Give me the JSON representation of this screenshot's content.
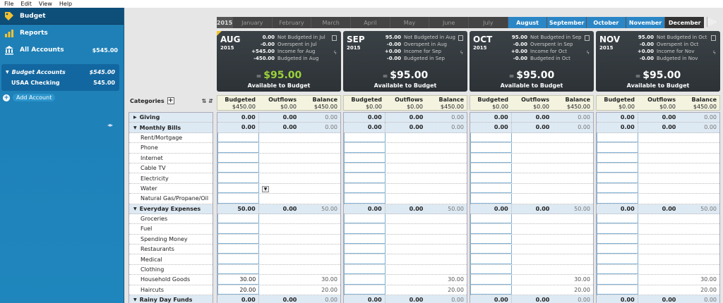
{
  "menu": [
    "File",
    "Edit",
    "View",
    "Help"
  ],
  "sidebar": {
    "nav": [
      {
        "label": "Budget",
        "icon": "tag-icon",
        "amount": ""
      },
      {
        "label": "Reports",
        "icon": "bar-chart-icon",
        "amount": ""
      },
      {
        "label": "All Accounts",
        "icon": "bank-icon",
        "amount": "$545.00"
      }
    ],
    "accounts_title": "Budget Accounts",
    "accounts_total": "$545.00",
    "accounts": [
      {
        "label": "USAA Checking",
        "amount": "545.00"
      }
    ],
    "add_account": "Add Account",
    "collapse_glyph": "◂▸"
  },
  "month_bar": {
    "year": "2015",
    "months": [
      "January",
      "February",
      "March",
      "April",
      "May",
      "June",
      "July",
      "August",
      "September",
      "October",
      "November",
      "December"
    ]
  },
  "categories_label": "Categories",
  "months": [
    {
      "mon": "AUG",
      "year": "2015",
      "vals": [
        "0.00",
        "-0.00",
        "+545.00",
        "-450.00"
      ],
      "labels": [
        "Not Budgeted in Jul",
        "Overspent in Jul",
        "Income for Aug",
        "Budgeted in Aug"
      ],
      "available": "$95.00",
      "available_label": "Available to Budget",
      "budgeted": "$450.00",
      "outflows": "$0.00",
      "balance": "$450.00"
    },
    {
      "mon": "SEP",
      "year": "2015",
      "vals": [
        "95.00",
        "-0.00",
        "+0.00",
        "-0.00"
      ],
      "labels": [
        "Not Budgeted in Aug",
        "Overspent in Aug",
        "Income for Sep",
        "Budgeted in Sep"
      ],
      "available": "$95.00",
      "available_label": "Available to Budget",
      "budgeted": "$0.00",
      "outflows": "$0.00",
      "balance": "$450.00"
    },
    {
      "mon": "OCT",
      "year": "2015",
      "vals": [
        "95.00",
        "-0.00",
        "+0.00",
        "-0.00"
      ],
      "labels": [
        "Not Budgeted in Sep",
        "Overspent in Sep",
        "Income for Oct",
        "Budgeted in Oct"
      ],
      "available": "$95.00",
      "available_label": "Available to Budget",
      "budgeted": "$0.00",
      "outflows": "$0.00",
      "balance": "$450.00"
    },
    {
      "mon": "NOV",
      "year": "2015",
      "vals": [
        "95.00",
        "-0.00",
        "+0.00",
        "-0.00"
      ],
      "labels": [
        "Not Budgeted in Oct",
        "Overspent in Oct",
        "Income for Nov",
        "Budgeted in Nov"
      ],
      "available": "$95.00",
      "available_label": "Available to Budget",
      "budgeted": "$0.00",
      "outflows": "$0.00",
      "balance": "$450.00"
    }
  ],
  "col_headers": [
    "Budgeted",
    "Outflows",
    "Balance"
  ],
  "rows": [
    {
      "name": "Giving",
      "group": true,
      "vals": [
        [
          "0.00",
          "0.00",
          "0.00"
        ],
        [
          "0.00",
          "0.00",
          "0.00"
        ],
        [
          "0.00",
          "0.00",
          "0.00"
        ],
        [
          "0.00",
          "0.00",
          "0.00"
        ]
      ]
    },
    {
      "name": "Monthly Bills",
      "group": true,
      "vals": [
        [
          "0.00",
          "0.00",
          "0.00"
        ],
        [
          "0.00",
          "0.00",
          "0.00"
        ],
        [
          "0.00",
          "0.00",
          "0.00"
        ],
        [
          "0.00",
          "0.00",
          "0.00"
        ]
      ]
    },
    {
      "name": "Rent/Mortgage",
      "group": false,
      "vals": [
        [
          "",
          "",
          ""
        ],
        [
          "",
          "",
          ""
        ],
        [
          "",
          "",
          ""
        ],
        [
          "",
          "",
          ""
        ]
      ]
    },
    {
      "name": "Phone",
      "group": false,
      "vals": [
        [
          "",
          "",
          ""
        ],
        [
          "",
          "",
          ""
        ],
        [
          "",
          "",
          ""
        ],
        [
          "",
          "",
          ""
        ]
      ]
    },
    {
      "name": "Internet",
      "group": false,
      "vals": [
        [
          "",
          "",
          ""
        ],
        [
          "",
          "",
          ""
        ],
        [
          "",
          "",
          ""
        ],
        [
          "",
          "",
          ""
        ]
      ]
    },
    {
      "name": "Cable TV",
      "group": false,
      "vals": [
        [
          "",
          "",
          ""
        ],
        [
          "",
          "",
          ""
        ],
        [
          "",
          "",
          ""
        ],
        [
          "",
          "",
          ""
        ]
      ]
    },
    {
      "name": "Electricity",
      "group": false,
      "vals": [
        [
          "",
          "",
          ""
        ],
        [
          "",
          "",
          ""
        ],
        [
          "",
          "",
          ""
        ],
        [
          "",
          "",
          ""
        ]
      ]
    },
    {
      "name": "Water",
      "group": false,
      "vals": [
        [
          "",
          "",
          ""
        ],
        [
          "",
          "",
          ""
        ],
        [
          "",
          "",
          ""
        ],
        [
          "",
          "",
          ""
        ]
      ]
    },
    {
      "name": "Natural Gas/Propane/Oil",
      "group": false,
      "vals": [
        [
          "",
          "",
          ""
        ],
        [
          "",
          "",
          ""
        ],
        [
          "",
          "",
          ""
        ],
        [
          "",
          "",
          ""
        ]
      ]
    },
    {
      "name": "Everyday Expenses",
      "group": true,
      "vals": [
        [
          "50.00",
          "0.00",
          "50.00"
        ],
        [
          "0.00",
          "0.00",
          "50.00"
        ],
        [
          "0.00",
          "0.00",
          "50.00"
        ],
        [
          "0.00",
          "0.00",
          "50.00"
        ]
      ]
    },
    {
      "name": "Groceries",
      "group": false,
      "vals": [
        [
          "",
          "",
          ""
        ],
        [
          "",
          "",
          ""
        ],
        [
          "",
          "",
          ""
        ],
        [
          "",
          "",
          ""
        ]
      ]
    },
    {
      "name": "Fuel",
      "group": false,
      "vals": [
        [
          "",
          "",
          ""
        ],
        [
          "",
          "",
          ""
        ],
        [
          "",
          "",
          ""
        ],
        [
          "",
          "",
          ""
        ]
      ]
    },
    {
      "name": "Spending Money",
      "group": false,
      "vals": [
        [
          "",
          "",
          ""
        ],
        [
          "",
          "",
          ""
        ],
        [
          "",
          "",
          ""
        ],
        [
          "",
          "",
          ""
        ]
      ]
    },
    {
      "name": "Restaurants",
      "group": false,
      "vals": [
        [
          "",
          "",
          ""
        ],
        [
          "",
          "",
          ""
        ],
        [
          "",
          "",
          ""
        ],
        [
          "",
          "",
          ""
        ]
      ]
    },
    {
      "name": "Medical",
      "group": false,
      "vals": [
        [
          "",
          "",
          ""
        ],
        [
          "",
          "",
          ""
        ],
        [
          "",
          "",
          ""
        ],
        [
          "",
          "",
          ""
        ]
      ]
    },
    {
      "name": "Clothing",
      "group": false,
      "vals": [
        [
          "",
          "",
          ""
        ],
        [
          "",
          "",
          ""
        ],
        [
          "",
          "",
          ""
        ],
        [
          "",
          "",
          ""
        ]
      ]
    },
    {
      "name": "Household Goods",
      "group": false,
      "vals": [
        [
          "30.00",
          "",
          "30.00"
        ],
        [
          "",
          "",
          "30.00"
        ],
        [
          "",
          "",
          "30.00"
        ],
        [
          "",
          "",
          "30.00"
        ]
      ]
    },
    {
      "name": "Haircuts",
      "group": false,
      "vals": [
        [
          "20.00",
          "",
          "20.00"
        ],
        [
          "",
          "",
          "20.00"
        ],
        [
          "",
          "",
          "20.00"
        ],
        [
          "",
          "",
          "20.00"
        ]
      ]
    },
    {
      "name": "Rainy Day Funds",
      "group": true,
      "vals": [
        [
          "0.00",
          "0.00",
          "0.00"
        ],
        [
          "0.00",
          "0.00",
          "0.00"
        ],
        [
          "0.00",
          "0.00",
          "0.00"
        ],
        [
          "0.00",
          "0.00",
          "0.00"
        ]
      ]
    }
  ]
}
